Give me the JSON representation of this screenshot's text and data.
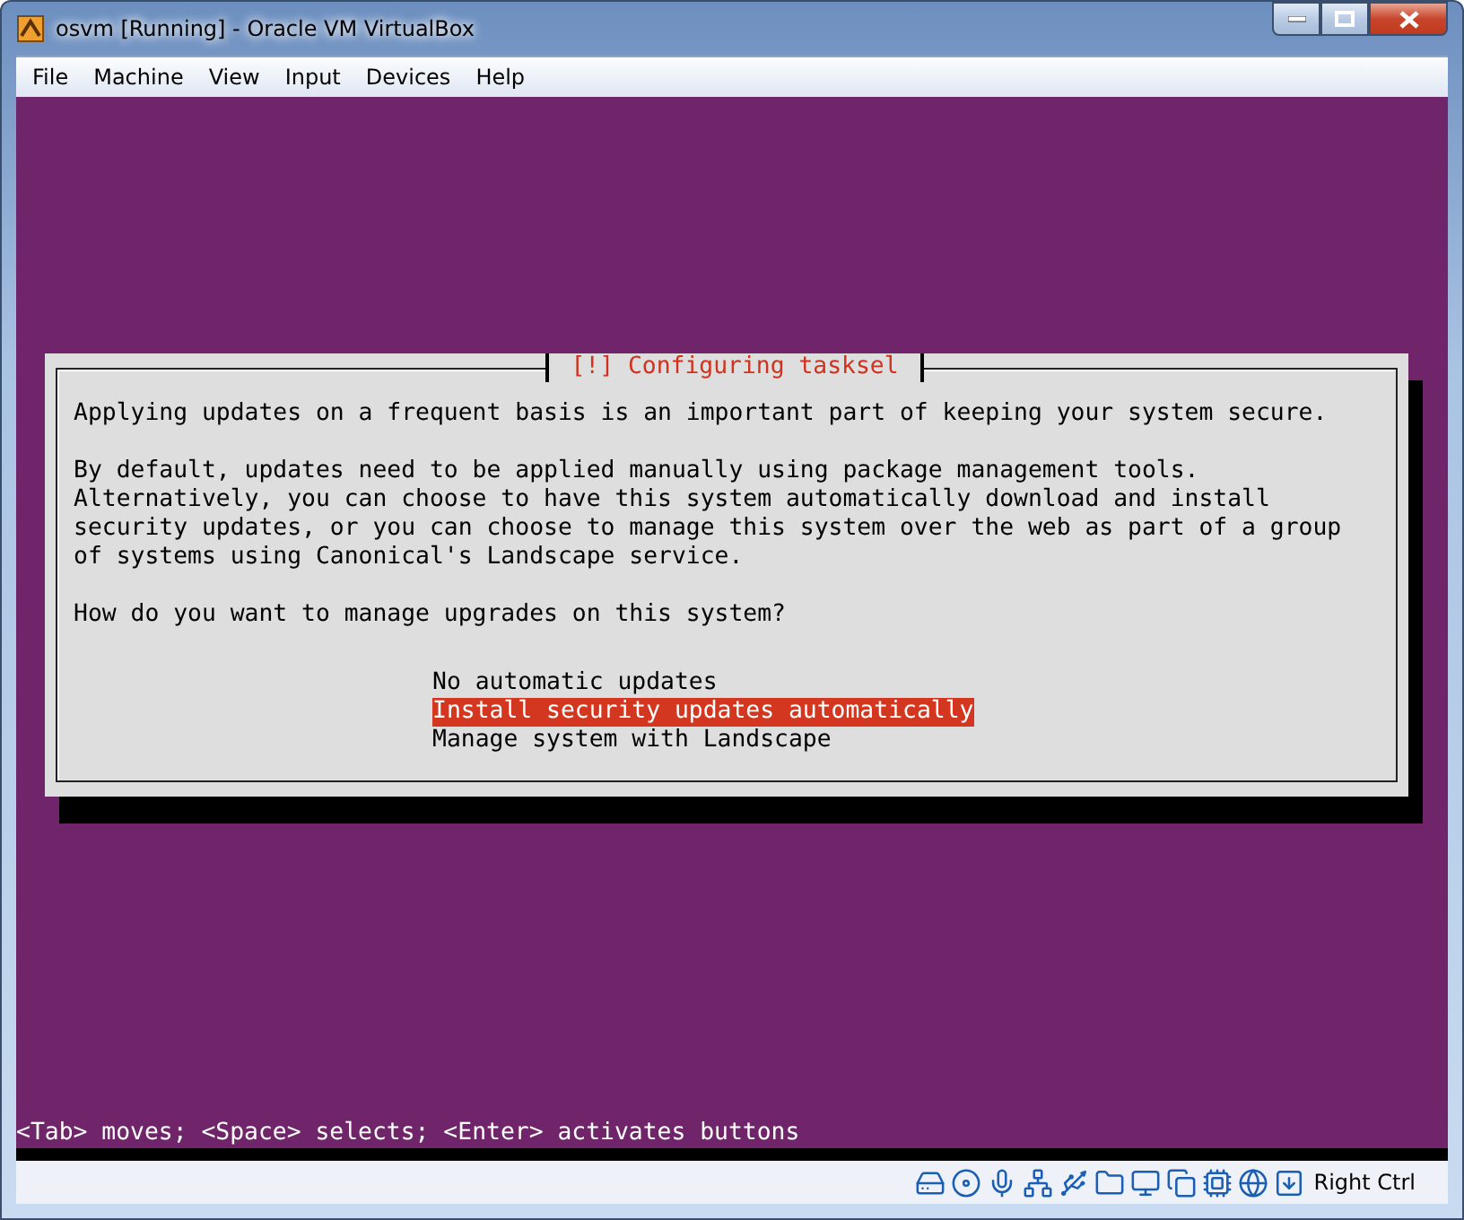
{
  "window": {
    "title": "osvm [Running] - Oracle VM VirtualBox"
  },
  "menu": [
    "File",
    "Machine",
    "View",
    "Input",
    "Devices",
    "Help"
  ],
  "dialog": {
    "title": "[!] Configuring tasksel",
    "paragraphs": [
      "Applying updates on a frequent basis is an important part of keeping your system secure.",
      "By default, updates need to be applied manually using package management tools.\nAlternatively, you can choose to have this system automatically download and install\nsecurity updates, or you can choose to manage this system over the web as part of a group\nof systems using Canonical's Landscape service.",
      "How do you want to manage upgrades on this system?"
    ],
    "options": [
      {
        "label": "No automatic updates",
        "selected": false
      },
      {
        "label": "Install security updates automatically",
        "selected": true
      },
      {
        "label": "Manage system with Landscape",
        "selected": false
      }
    ]
  },
  "hint": "<Tab> moves; <Space> selects; <Enter> activates buttons",
  "status_bar": {
    "host_key": "Right Ctrl"
  }
}
